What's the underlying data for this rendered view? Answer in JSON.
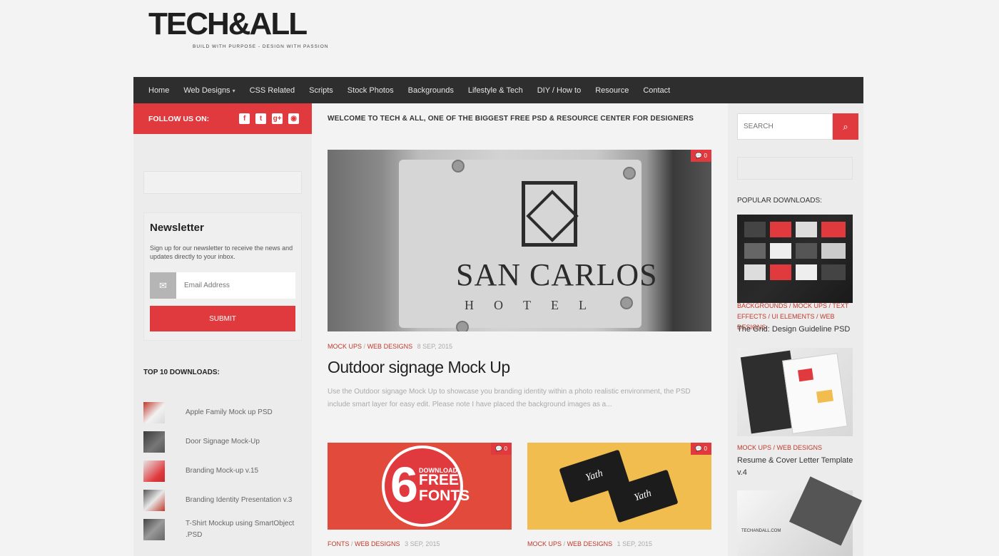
{
  "header": {
    "logo_text": "TECH&ALL",
    "tagline": "BUILD WITH PURPOSE - DESIGN WITH PASSION"
  },
  "nav": {
    "items": [
      "Home",
      "Web Designs",
      "CSS Related",
      "Scripts",
      "Stock Photos",
      "Backgrounds",
      "Lifestyle & Tech",
      "DIY / How to",
      "Resource",
      "Contact"
    ],
    "dropdown_caret": "▾"
  },
  "follow": {
    "label": "FOLLOW US ON:",
    "icons": [
      "facebook-icon",
      "twitter-icon",
      "google-plus-icon",
      "rss-icon"
    ],
    "glyphs": [
      "f",
      "t",
      "g+",
      "◉"
    ]
  },
  "newsletter": {
    "title": "Newsletter",
    "text": "Sign up for our newsletter to receive the news and updates directly to your inbox.",
    "email_placeholder": "Email Address",
    "submit_label": "SUBMIT"
  },
  "top10": {
    "title": "TOP 10 DOWNLOADS:",
    "items": [
      "Apple Family Mock up PSD",
      "Door Signage Mock-Up",
      "Branding Mock-up v.15",
      "Branding Identity Presentation v.3",
      "T-Shirt Mockup using SmartObject .PSD"
    ]
  },
  "main": {
    "welcome": "WELCOME TO TECH & ALL, ONE OF THE BIGGEST FREE PSD & RESOURCE CENTER FOR DESIGNERS",
    "featured": {
      "sign_name": "SAN CARLOS",
      "sign_sub": "HOTEL",
      "comments": "0",
      "cat1": "MOCK UPS",
      "cat2": "WEB DESIGNS",
      "sep": "/",
      "date": "8 SEP, 2015",
      "title": "Outdoor signage Mock Up",
      "excerpt": "Use the Outdoor signage Mock Up to showcase you branding identity within a photo realistic environment, the PSD include smart layer for easy edit. Please note I have placed the background images as a..."
    },
    "cards": [
      {
        "cat1": "FONTS",
        "cat2": "WEB DESIGNS",
        "date": "3 SEP, 2015",
        "comments": "0",
        "big_number": "6",
        "small": "DOWNLOAD",
        "big1": "FREE",
        "big2": "FONTS"
      },
      {
        "cat1": "MOCK UPS",
        "cat2": "WEB DESIGNS",
        "date": "1 SEP, 2015",
        "comments": "0",
        "brand": "Yath"
      }
    ]
  },
  "sidebar_right": {
    "search_placeholder": "SEARCH",
    "popular_title": "POPULAR DOWNLOADS:",
    "popular": [
      {
        "cats": "BACKGROUNDS / MOCK UPS / TEXT EFFECTS / UI ELEMENTS / WEB DESIGNS",
        "name": "The Grid: Design Guideline PSD"
      },
      {
        "cats": "MOCK UPS / WEB DESIGNS",
        "name": "Resume & Cover Letter Template v.4"
      },
      {
        "watermark": "TECHANDALL.COM"
      }
    ]
  },
  "colors": {
    "accent": "#e03a3e",
    "nav_bg": "#2e2e2e",
    "page_bg": "#f3f3f3"
  }
}
